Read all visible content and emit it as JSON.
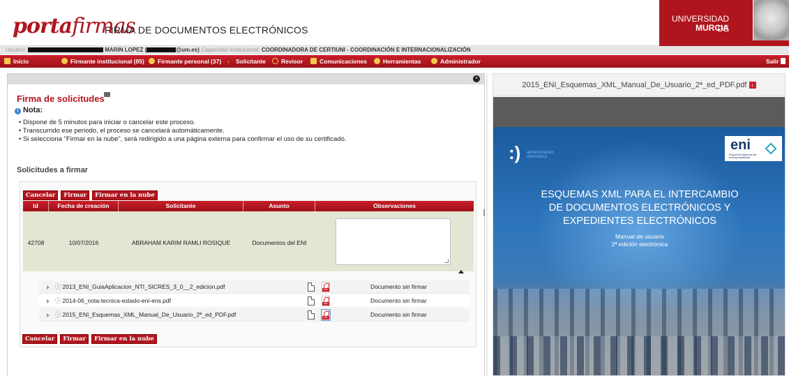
{
  "app": {
    "logo_part1": "porta",
    "logo_part2": "firmas",
    "subtitle": "FIRMA DE DOCUMENTOS ELECTRÓNICOS",
    "university_line1": "UNIVERSIDAD DE",
    "university_line2": "MURCIA"
  },
  "userbar": {
    "label": "Usuario:",
    "name": "MARIN LOPEZ (",
    "email_suffix": "@um.es)",
    "cap_label": "Capacidad institucional:",
    "cap_value": "COORDINADORA DE CERTIUNI - COORDINACIÓN E INTERNACIONALIZACIÓN"
  },
  "nav": {
    "inicio": "Inicio",
    "firmante_inst": "Firmante institucional (85)",
    "firmante_pers": "Firmante personal (37)",
    "solicitante": "Solicitante",
    "revisor": "Revisor",
    "comunicaciones": "Comunicaciones",
    "herramientas": "Herramientas",
    "administrador": "Administrador",
    "salir": "Salir"
  },
  "panel": {
    "title": "Firma de solicitudes",
    "nota_label": "Nota:",
    "notes": [
      "Dispone de 5 minutos para iniciar o cancelar este proceso.",
      "Transcurrido ese periodo, el proceso se cancelará automáticamente.",
      "Si selecciona \"Firmar en la nube\", será redirigido a una página externa para confirmar el uso de su certificado."
    ],
    "section_title": "Solicitudes a firmar"
  },
  "buttons": {
    "cancelar": "Cancelar",
    "firmar": "Firmar",
    "firmar_nube": "Firmar en la nube"
  },
  "table": {
    "headers": [
      "Id",
      "Fecha de creación",
      "Solicitante",
      "Asunto",
      "Observaciones"
    ],
    "row": {
      "id": "42708",
      "fecha": "10/07/2016",
      "solicitante": "ABRAHAM KARIM RAMLI ROSIQUE",
      "asunto": "Documentos del ENI",
      "observaciones": ""
    },
    "files": [
      {
        "name": "2013_ENI_GuiaAplicacion_NTI_SICRES_3_0__2_edicion.pdf",
        "status": "Documento sin firmar"
      },
      {
        "name": "2014-06_nota-tecnica-estado-eni-ens.pdf",
        "status": "Documento sin firmar"
      },
      {
        "name": "2015_ENI_Esquemas_XML_Manual_De_Usuario_2ª_ed_PDF.pdf",
        "status": "Documento sin firmar"
      }
    ]
  },
  "preview": {
    "filename": "2015_ENI_Esquemas_XML_Manual_De_Usuario_2ª_ed_PDF.pdf",
    "adm_text_1": "administración",
    "adm_text_2": "electrónica",
    "eni_logo": "eni",
    "eni_sub_1": "Esquema Nacional de",
    "eni_sub_2": "Interoperabilidad",
    "cover_title_1": "ESQUEMAS XML PARA EL INTERCAMBIO",
    "cover_title_2": "DE DOCUMENTOS ELECTRÓNICOS Y",
    "cover_title_3": "EXPEDIENTES ELECTRÓNICOS",
    "cover_sub_1": "Manual de usuario",
    "cover_sub_2": "2ª edición electrónica"
  },
  "colors": {
    "brand_red": "#b0151e",
    "nav_red": "#c8202a",
    "cover_blue": "#2e76bc"
  }
}
